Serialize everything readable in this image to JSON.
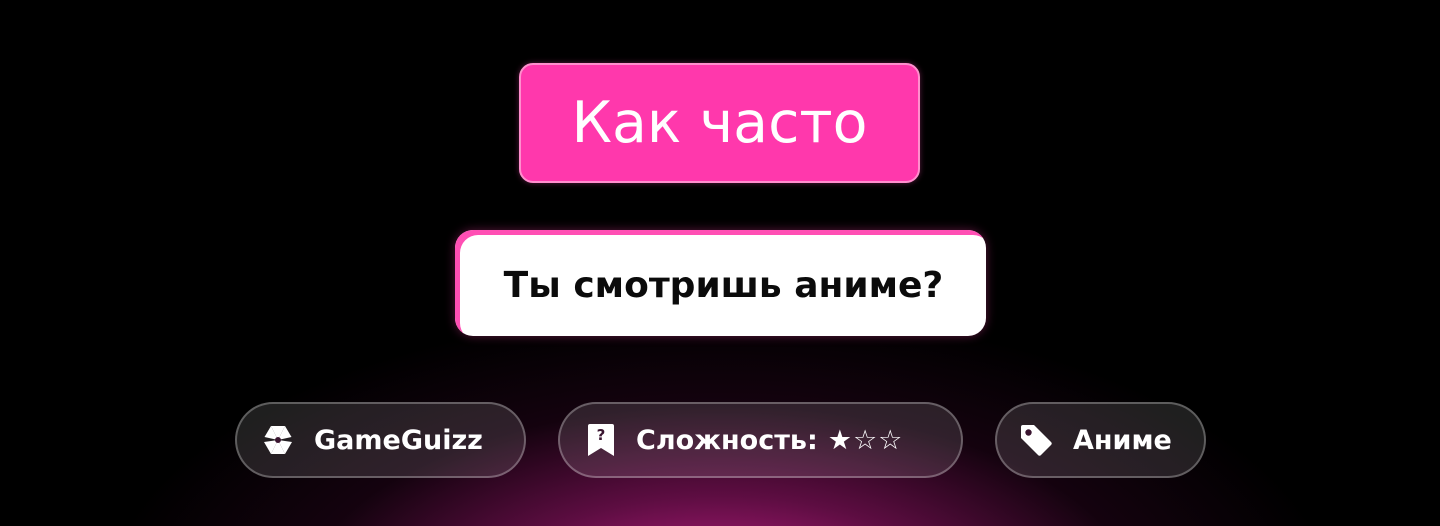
{
  "title": "Как часто",
  "question": "Ты смотришь аниме?",
  "tags": {
    "brand": {
      "label": "GameGuizz",
      "icon": "gameguizz-logo-icon"
    },
    "difficulty": {
      "label": "Сложность:",
      "stars": "★☆☆",
      "icon": "question-bookmark-icon",
      "rating": 1,
      "max": 3
    },
    "topic": {
      "label": "Аниме",
      "icon": "tag-icon"
    }
  },
  "colors": {
    "accent": "#ff38ac",
    "accent_border": "#ff8fce",
    "background": "#000000",
    "glow": "#e824a0",
    "question_bg": "#ffffff",
    "question_text": "#0b0b0b"
  }
}
